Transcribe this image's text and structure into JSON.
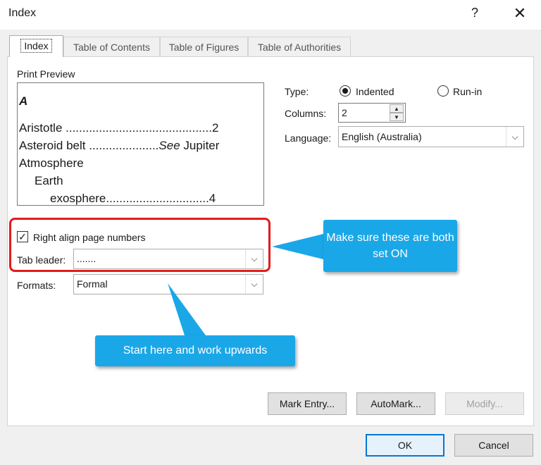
{
  "window": {
    "title": "Index",
    "help_icon": "?",
    "close_icon": "✕"
  },
  "tabs": [
    {
      "label": "Index",
      "active": true
    },
    {
      "label": "Table of Contents",
      "active": false
    },
    {
      "label": "Table of Figures",
      "active": false
    },
    {
      "label": "Table of Authorities",
      "active": false
    }
  ],
  "print_preview": {
    "label": "Print Preview",
    "lines": [
      {
        "text": "A",
        "style": "bold-italic"
      },
      {
        "text": "Aristotle ............................................2"
      },
      {
        "text_a": "Asteroid belt .....................",
        "text_b": "See",
        "text_c": "Jupiter"
      },
      {
        "text": "Atmosphere"
      },
      {
        "text": "Earth"
      },
      {
        "text": "exosphere...............................4"
      }
    ]
  },
  "type": {
    "label": "Type:",
    "options": [
      {
        "label": "Indented",
        "selected": true
      },
      {
        "label": "Run-in",
        "selected": false
      }
    ]
  },
  "columns": {
    "label": "Columns:",
    "value": "2"
  },
  "language": {
    "label": "Language:",
    "value": "English (Australia)"
  },
  "right_align": {
    "label": "Right align page numbers",
    "checked": true
  },
  "tab_leader": {
    "label": "Tab leader:",
    "value": "......."
  },
  "formats": {
    "label": "Formats:",
    "value": "Formal"
  },
  "buttons": {
    "mark_entry": "Mark Entry...",
    "automark": "AutoMark...",
    "modify": "Modify...",
    "ok": "OK",
    "cancel": "Cancel"
  },
  "annotations": {
    "callout_right": "Make sure these are both set ON",
    "callout_bottom": "Start here and work upwards",
    "callout_color": "#1aa7e8",
    "highlight_color": "#e21b1b"
  }
}
